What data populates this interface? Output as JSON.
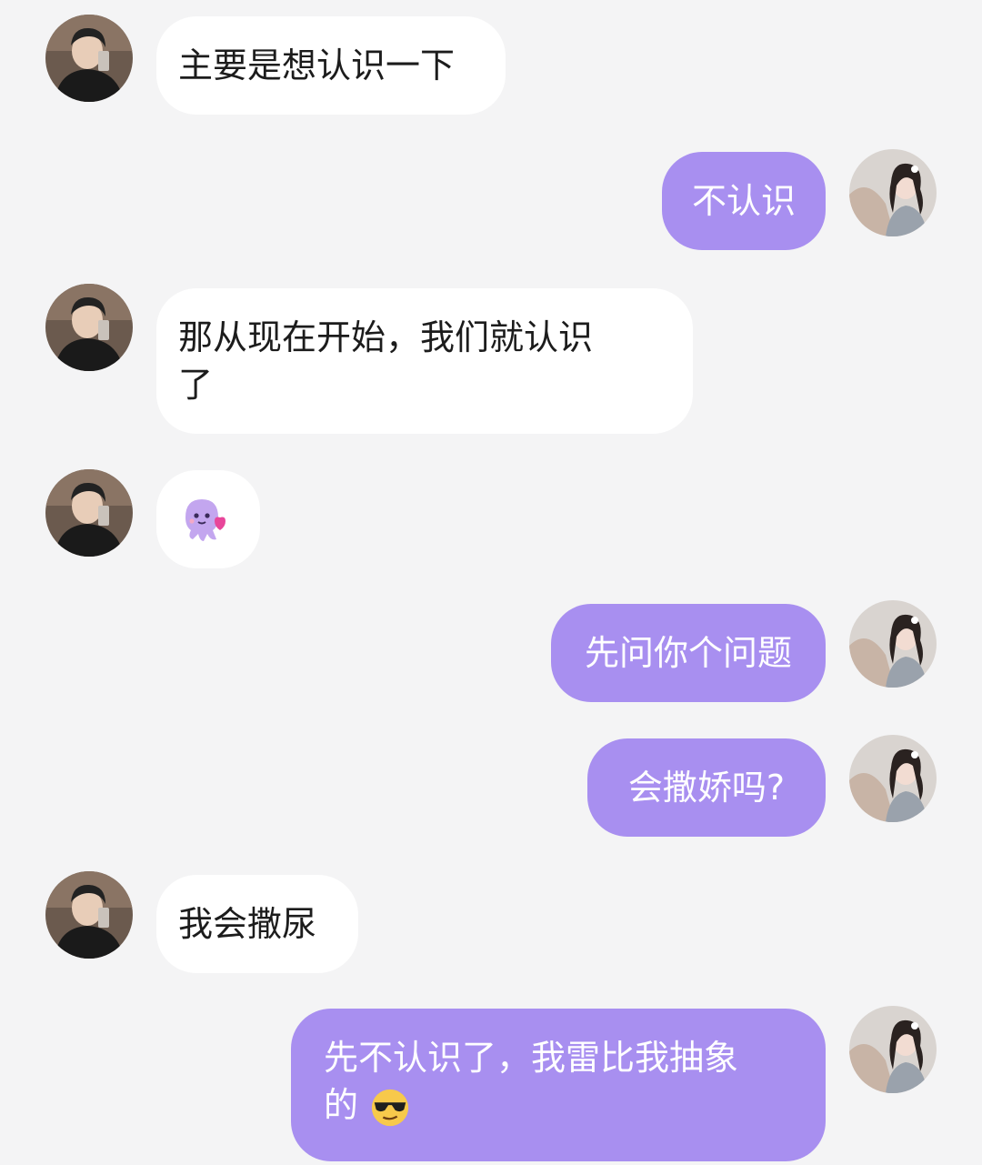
{
  "conversation": {
    "messages": [
      {
        "sender": "other",
        "text": "主要是想认识一下"
      },
      {
        "sender": "me",
        "text": "不认识"
      },
      {
        "sender": "other",
        "text": "那从现在开始，我们就认识了"
      },
      {
        "sender": "other",
        "sticker": "octopus-emoji-icon"
      },
      {
        "sender": "me",
        "text": "先问你个问题"
      },
      {
        "sender": "me",
        "text": "会撒娇吗?"
      },
      {
        "sender": "other",
        "text": "我会撒尿"
      },
      {
        "sender": "me",
        "text": "先不认识了，我雷比我抽象的",
        "trailing_emoji": "sunglasses-face-emoji-icon"
      }
    ]
  },
  "theme": {
    "background": "#f4f4f5",
    "incoming_bubble": "#ffffff",
    "outgoing_bubble": "#a88ff0"
  }
}
